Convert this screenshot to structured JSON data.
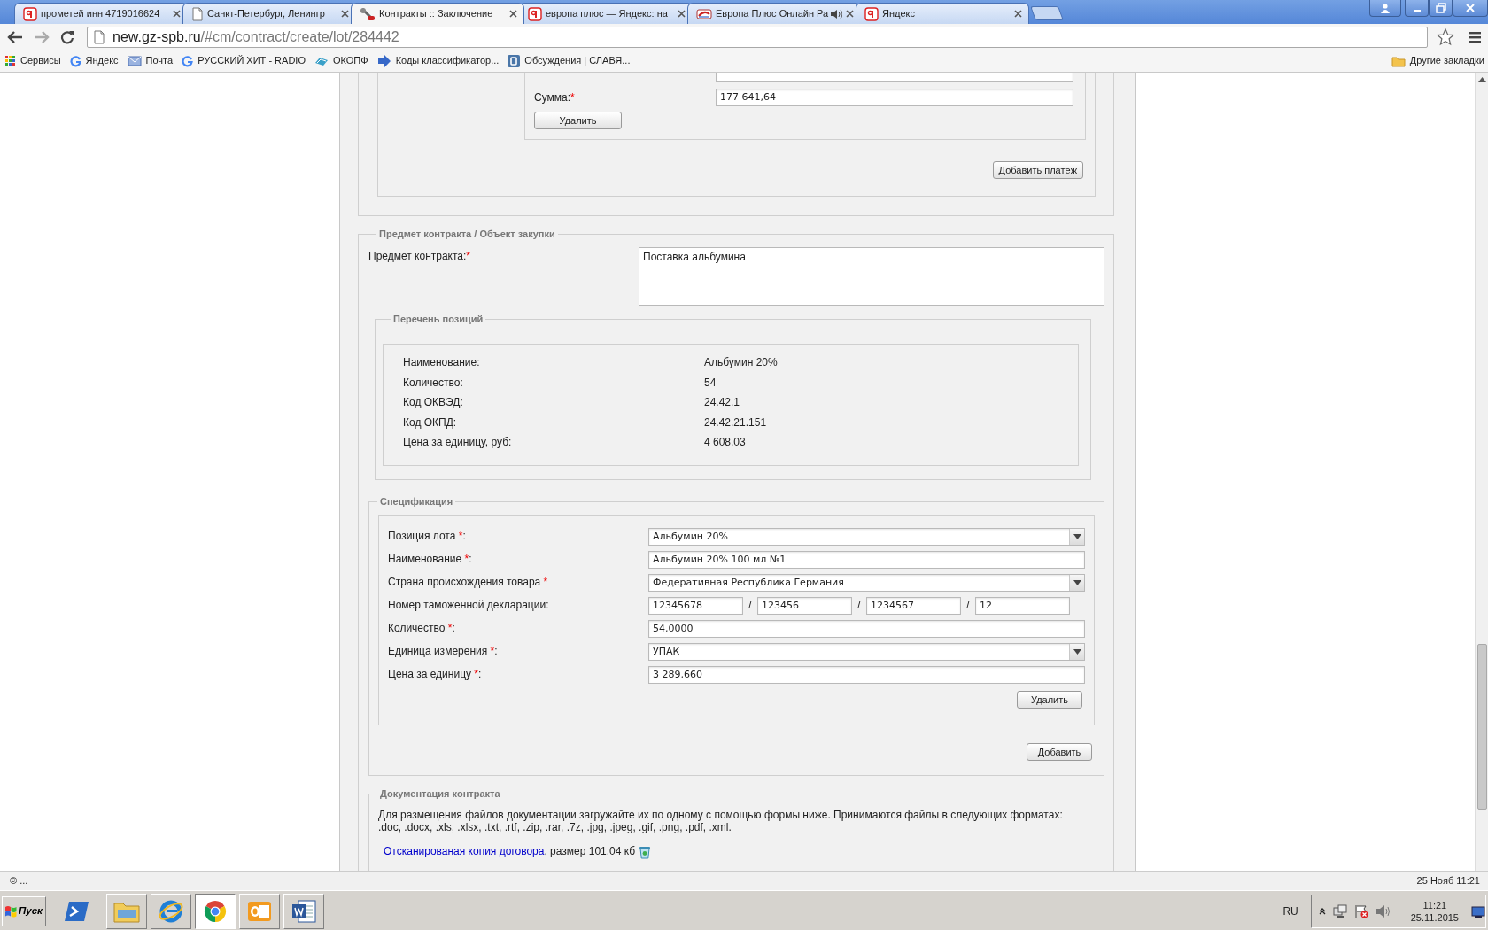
{
  "browser": {
    "tabs": [
      {
        "title": "прометей инн 4719016624",
        "kind": "y",
        "selected": false,
        "audio": false
      },
      {
        "title": "Санкт-Петербург, Ленингр",
        "kind": "page",
        "selected": false,
        "audio": false
      },
      {
        "title": "Контракты :: Заключение",
        "kind": "tools",
        "selected": true,
        "audio": false
      },
      {
        "title": "европа плюс — Яндекс: на",
        "kind": "y",
        "selected": false,
        "audio": false
      },
      {
        "title": "Европа Плюс Онлайн Ра",
        "kind": "radio",
        "selected": false,
        "audio": true
      },
      {
        "title": "Яндекс",
        "kind": "y",
        "selected": false,
        "audio": false
      }
    ],
    "address": {
      "host": "new.gz-spb.ru",
      "path": "/#cm/contract/create/lot/284442"
    },
    "bookmarks": [
      {
        "label": "Сервисы",
        "kind": "apps"
      },
      {
        "label": "Яндекс",
        "kind": "g"
      },
      {
        "label": "Почта",
        "kind": "mail"
      },
      {
        "label": "РУССКИЙ ХИТ - RADIO",
        "kind": "g"
      },
      {
        "label": "ОКОПФ",
        "kind": "hand"
      },
      {
        "label": "Коды классификатор...",
        "kind": "arrow"
      },
      {
        "label": "Обсуждения | СЛАВЯ...",
        "kind": "vk"
      }
    ],
    "other_bookmarks": "Другие закладки"
  },
  "payment": {
    "rows": [
      {
        "label": "Сумма:",
        "mark": "*",
        "value": "177 641,64"
      }
    ],
    "delete_button": "Удалить",
    "add_button": "Добавить платёж"
  },
  "subject": {
    "legend": "Предмет контракта / Объект закупки",
    "label": "Предмет контракта:",
    "mark": "*",
    "value": "Поставка альбумина"
  },
  "positions": {
    "legend": "Перечень позиций",
    "rows": [
      {
        "label": "Наименование:",
        "value": "Альбумин 20%"
      },
      {
        "label": "Количество:",
        "value": "54"
      },
      {
        "label": "Код ОКВЭД:",
        "value": "24.42.1"
      },
      {
        "label": "Код ОКПД:",
        "value": "24.42.21.151"
      },
      {
        "label": "Цена за единицу, руб:",
        "value": "4 608,03"
      }
    ]
  },
  "specification": {
    "legend": "Спецификация",
    "rows": [
      {
        "kind": "select",
        "label": "Позиция лота",
        "mark": "*",
        "suffix": ":",
        "value": "Альбумин 20%"
      },
      {
        "kind": "text",
        "label": "Наименование",
        "mark": "*",
        "suffix": ":",
        "value": "Альбумин 20% 100 мл №1"
      },
      {
        "kind": "select",
        "label": "Страна происхождения товара",
        "mark": "*",
        "value": "Федеративная Республика Германия"
      },
      {
        "kind": "parts",
        "label": "Номер таможенной декларации:",
        "parts": [
          {
            "value": "12345678"
          },
          {
            "separator": "/",
            "value": "123456"
          },
          {
            "separator": "/",
            "value": "1234567"
          },
          {
            "separator": "/",
            "value": "12"
          }
        ]
      },
      {
        "kind": "text",
        "label": "Количество",
        "mark": "*",
        "suffix": ":",
        "value": "54,0000"
      },
      {
        "kind": "select",
        "label": "Единица измерения",
        "mark": "*",
        "suffix": ":",
        "value": "УПАК"
      },
      {
        "kind": "text",
        "label": "Цена за единицу",
        "mark": "*",
        "suffix": ":",
        "value": "3 289,660"
      }
    ],
    "delete_button": "Удалить",
    "add_button": "Добавить"
  },
  "documentation": {
    "legend": "Документация контракта",
    "description": "Для размещения файлов документации загружайте их по одному с помощью формы ниже. Принимаются файлы в следующих форматах:\n.doc, .docx, .xls, .xlsx, .txt, .rtf, .zip, .rar, .7z, .jpg, .jpeg, .gif, .png, .pdf, .xml.",
    "file": {
      "link": "Отсканированая копия договора",
      "info": ", размер 101.04 кб"
    }
  },
  "status_bar": {
    "left": "© ...",
    "right": "25 Нояб 11:21"
  },
  "taskbar": {
    "start": "Пуск",
    "apps": [
      {
        "kind": "terminal",
        "active": false
      },
      {
        "kind": "folder",
        "active": false
      },
      {
        "kind": "ie",
        "active": false
      },
      {
        "kind": "chrome",
        "active": true
      },
      {
        "kind": "outlook",
        "active": false
      },
      {
        "kind": "word",
        "active": false
      }
    ],
    "language": "RU",
    "time": "11:21",
    "date": "25.11.2015"
  }
}
